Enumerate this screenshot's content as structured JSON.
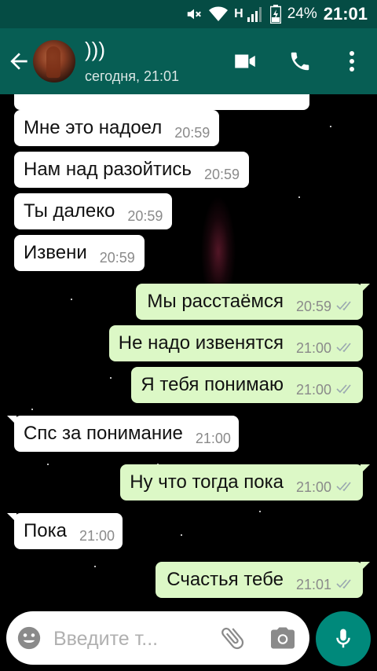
{
  "status_bar": {
    "network_label": "H",
    "battery_percent": "24%",
    "time": "21:01"
  },
  "header": {
    "contact_name": ")))",
    "last_seen": "сегодня, 21:01"
  },
  "messages": [
    {
      "direction": "in",
      "text": "Мне это надоел",
      "time": "20:59"
    },
    {
      "direction": "in",
      "text": "Нам над разойтись",
      "time": "20:59"
    },
    {
      "direction": "in",
      "text": "Ты далеко",
      "time": "20:59"
    },
    {
      "direction": "in",
      "text": "Извени",
      "time": "20:59"
    },
    {
      "direction": "out",
      "text": "Мы расстаёмся",
      "time": "20:59"
    },
    {
      "direction": "out",
      "text": "Не надо извенятся",
      "time": "21:00"
    },
    {
      "direction": "out",
      "text": "Я тебя понимаю",
      "time": "21:00"
    },
    {
      "direction": "in",
      "text": "Спс за понимание",
      "time": "21:00"
    },
    {
      "direction": "out",
      "text": "Ну что тогда пока",
      "time": "21:00"
    },
    {
      "direction": "in",
      "text": "Пока",
      "time": "21:00"
    },
    {
      "direction": "out",
      "text": "Счастья тебе",
      "time": "21:01"
    }
  ],
  "composer": {
    "placeholder": "Введите т..."
  },
  "colors": {
    "header": "#075e54",
    "status_bar": "#054c44",
    "outgoing_bubble": "#dcf8c6",
    "incoming_bubble": "#ffffff",
    "mic_button": "#00897b",
    "read_ticks": "#9aa8b0"
  },
  "icons": {
    "back": "arrow-left-icon",
    "video": "video-camera-icon",
    "call": "phone-icon",
    "menu": "more-vert-icon",
    "emoji": "smiley-icon",
    "attach": "paperclip-icon",
    "camera": "camera-icon",
    "mic": "microphone-icon"
  }
}
